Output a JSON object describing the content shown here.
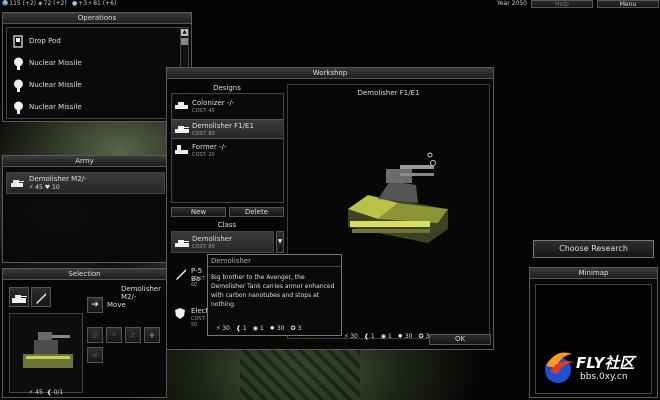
{
  "topbar": {
    "resources": [
      {
        "icon": "people-icon",
        "glyph": "☻",
        "value": "115 (+2)"
      },
      {
        "icon": "metal-icon",
        "glyph": "◈",
        "value": "72 (+2)"
      },
      {
        "icon": "energy-icon",
        "glyph": "●",
        "value": "+3"
      },
      {
        "icon": "power-icon",
        "glyph": "⚡",
        "value": "81 (+6)"
      }
    ],
    "year": "Year 2050",
    "help_label": "Help",
    "menu_label": "Menu"
  },
  "operations": {
    "title": "Operations",
    "items": [
      {
        "label": "Drop Pod",
        "icon": "drop-pod-icon"
      },
      {
        "label": "Nuclear Missile",
        "icon": "nuclear-icon"
      },
      {
        "label": "Nuclear Missile",
        "icon": "nuclear-icon"
      },
      {
        "label": "Nuclear Missile",
        "icon": "nuclear-icon"
      }
    ]
  },
  "army": {
    "title": "Army",
    "unit": {
      "name": "Demolisher M2/-",
      "speed": "45",
      "health": "10"
    }
  },
  "selection": {
    "title": "Selection",
    "unit_name": "Demolisher M2/-",
    "action_label": "Move",
    "speed": "45",
    "count": "0/1"
  },
  "workshop": {
    "title": "Workshop",
    "designs_title": "Designs",
    "designs": [
      {
        "name": "Colonizer -/-",
        "cost": "COST: 45"
      },
      {
        "name": "Demolisher F1/E1",
        "cost": "COST: 80"
      },
      {
        "name": "Former -/-",
        "cost": "COST: 20"
      }
    ],
    "new_label": "New",
    "delete_label": "Delete",
    "class_title": "Class",
    "class_selected": "Demolisher",
    "class_cost": "COST: 80",
    "weapon_name": "P-5 Ba",
    "weapon_cost": "COST: 60",
    "armor_name": "Electr",
    "armor_sub": "- Heavy",
    "armor_cost": "COST: 50",
    "preview_title": "Demolisher F1/E1",
    "ok_label": "OK",
    "stats": [
      {
        "icon": "attack-icon",
        "glyph": "⚡",
        "value": "30"
      },
      {
        "icon": "speed-icon",
        "glyph": "❰",
        "value": "1"
      },
      {
        "icon": "sight-icon",
        "glyph": "◉",
        "value": "1"
      },
      {
        "icon": "armor-icon",
        "glyph": "✹",
        "value": "30"
      },
      {
        "icon": "cost-icon",
        "glyph": "✪",
        "value": "3"
      }
    ]
  },
  "tooltip": {
    "title": "Demolisher",
    "text": "Big brother to the Avenger, the Demolisher Tank carries armor enhanced with carbon nanotubes and stops at nothing.",
    "stats": [
      {
        "icon": "attack-icon",
        "glyph": "⚡",
        "value": "30"
      },
      {
        "icon": "speed-icon",
        "glyph": "❰",
        "value": "1"
      },
      {
        "icon": "sight-icon",
        "glyph": "◉",
        "value": "1"
      },
      {
        "icon": "armor-icon",
        "glyph": "✹",
        "value": "30"
      },
      {
        "icon": "cost-icon",
        "glyph": "✪",
        "value": "3"
      }
    ]
  },
  "research": {
    "button_label": "Choose Research"
  },
  "minimap": {
    "title": "Minimap"
  },
  "watermark": {
    "brand": "FLY社区",
    "url": "bbs.0xy.cn"
  }
}
